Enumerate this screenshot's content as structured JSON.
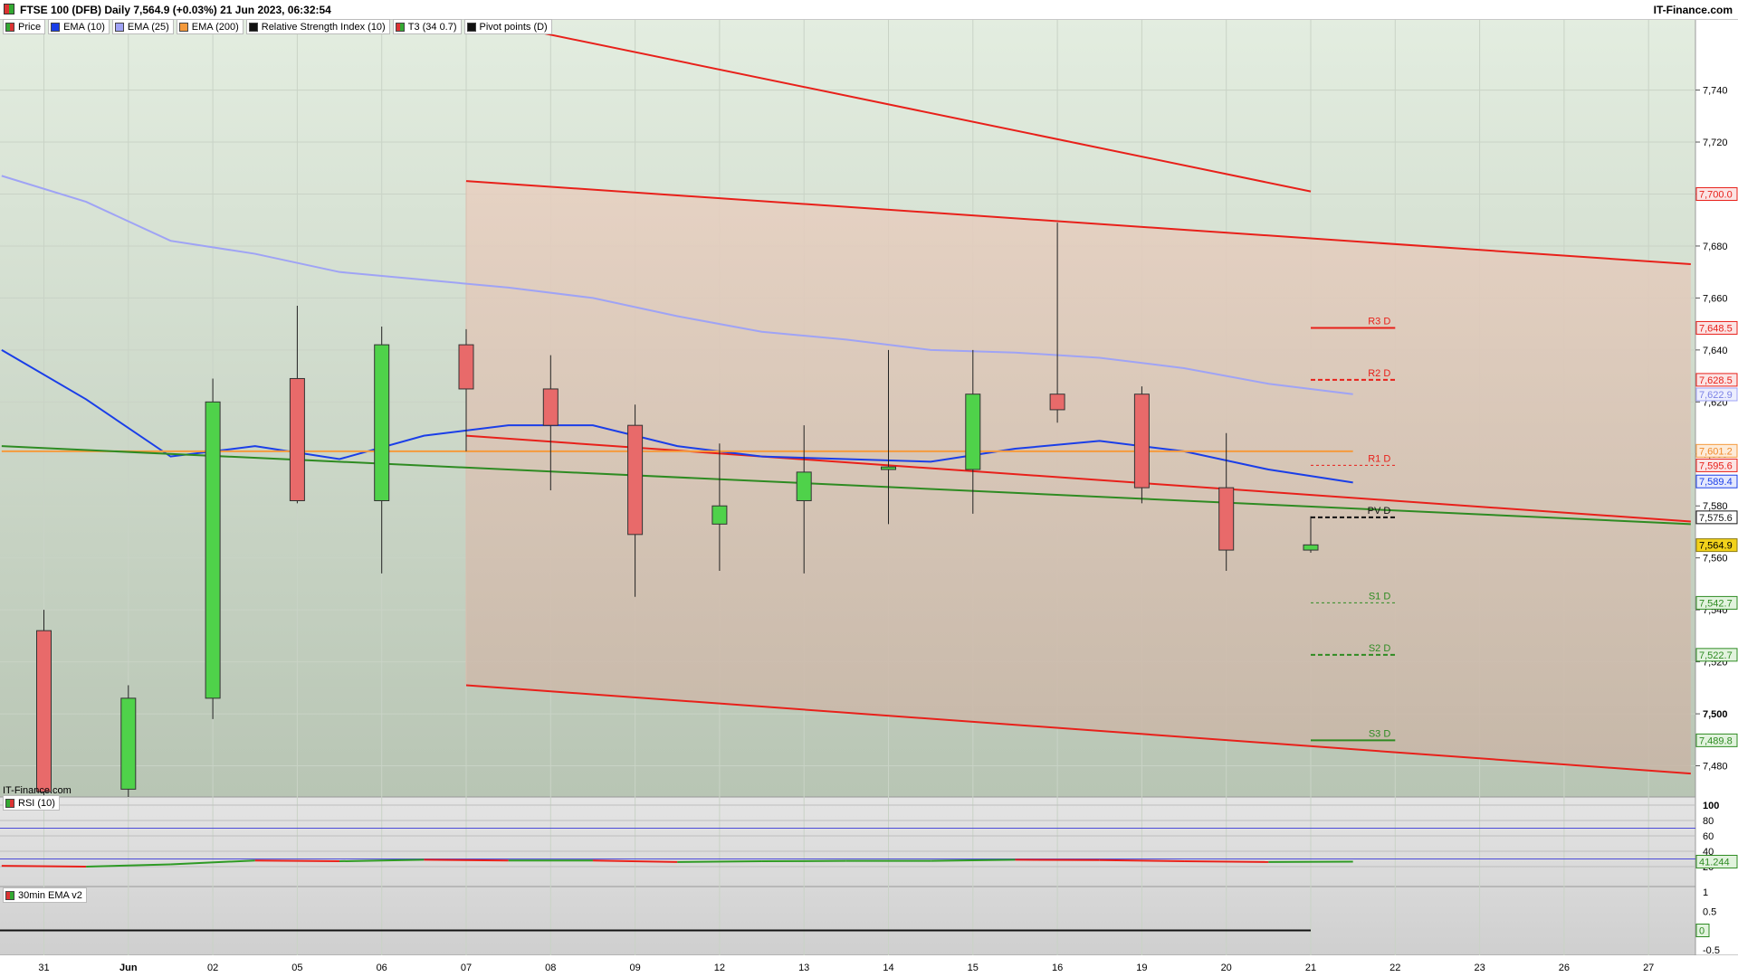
{
  "header": {
    "title": "FTSE 100 (DFB) Daily 7,564.9 (+0.03%) 21 Jun 2023, 06:32:54",
    "brand": "IT-Finance.com"
  },
  "legend": [
    {
      "label": "Price",
      "color": "#4caf50",
      "icon": "candle-icon"
    },
    {
      "label": "EMA (10)",
      "color": "#1a3ee8",
      "icon": "line-icon"
    },
    {
      "label": "EMA (25)",
      "color": "#9fa3f5",
      "icon": "line-icon"
    },
    {
      "label": "EMA (200)",
      "color": "#f59a3c",
      "icon": "line-icon"
    },
    {
      "label": "Relative Strength Index (10)",
      "color": "#111111",
      "icon": "line-icon"
    },
    {
      "label": "T3 (34 0.7)",
      "color": "#d9302e",
      "icon": "line-icon"
    },
    {
      "label": "Pivot points (D)",
      "color": "#111111",
      "icon": "line-icon"
    }
  ],
  "watermark": "IT-Finance.com",
  "rsi_panel": {
    "label": "RSI (10)",
    "current": "41.244"
  },
  "ema_panel": {
    "label": "30min EMA v2"
  },
  "chart_data": {
    "type": "candlestick",
    "title": "FTSE 100 (DFB) Daily",
    "x_labels": [
      "31",
      "Jun",
      "02",
      "05",
      "06",
      "07",
      "08",
      "09",
      "12",
      "13",
      "14",
      "15",
      "16",
      "19",
      "20",
      "21",
      "22",
      "23",
      "26",
      "27"
    ],
    "y_ticks": [
      7480,
      7500,
      7520,
      7540,
      7560,
      7580,
      7600,
      7620,
      7640,
      7660,
      7680,
      7700,
      7720,
      7740
    ],
    "ylim": [
      7468,
      7767
    ],
    "candles": [
      {
        "date": "31",
        "open": 7532,
        "high": 7540,
        "low": 7468,
        "close": 7470
      },
      {
        "date": "Jun",
        "open": 7471,
        "high": 7511,
        "low": 7468,
        "close": 7506
      },
      {
        "date": "02",
        "open": 7506,
        "high": 7629,
        "low": 7498,
        "close": 7620
      },
      {
        "date": "05",
        "open": 7629,
        "high": 7657,
        "low": 7581,
        "close": 7582
      },
      {
        "date": "06",
        "open": 7582,
        "high": 7649,
        "low": 7554,
        "close": 7642
      },
      {
        "date": "07",
        "open": 7642,
        "high": 7648,
        "low": 7601,
        "close": 7625
      },
      {
        "date": "08",
        "open": 7625,
        "high": 7638,
        "low": 7586,
        "close": 7611
      },
      {
        "date": "09",
        "open": 7611,
        "high": 7619,
        "low": 7545,
        "close": 7569
      },
      {
        "date": "12",
        "open": 7573,
        "high": 7604,
        "low": 7555,
        "close": 7580
      },
      {
        "date": "13",
        "open": 7582,
        "high": 7611,
        "low": 7554,
        "close": 7593
      },
      {
        "date": "14",
        "open": 7594,
        "high": 7640,
        "low": 7573,
        "close": 7595
      },
      {
        "date": "15",
        "open": 7594,
        "high": 7640,
        "low": 7577,
        "close": 7623
      },
      {
        "date": "16",
        "open": 7623,
        "high": 7689,
        "low": 7612,
        "close": 7617
      },
      {
        "date": "19",
        "open": 7623,
        "high": 7626,
        "low": 7581,
        "close": 7587
      },
      {
        "date": "20",
        "open": 7587,
        "high": 7608,
        "low": 7555,
        "close": 7563
      },
      {
        "date": "21",
        "open": 7563,
        "high": 7576,
        "low": 7562,
        "close": 7565
      }
    ],
    "series": [
      {
        "name": "EMA (10)",
        "color": "#1a3ee8",
        "values": [
          7640,
          7621,
          7599,
          7603,
          7598,
          7607,
          7611,
          7611,
          7603,
          7599,
          7598,
          7597,
          7602,
          7605,
          7601,
          7594,
          7589
        ]
      },
      {
        "name": "EMA (25)",
        "color": "#9fa3f5",
        "values": [
          7707,
          7697,
          7682,
          7677,
          7670,
          7667,
          7664,
          7660,
          7653,
          7647,
          7644,
          7640,
          7639,
          7637,
          7633,
          7627,
          7623
        ]
      },
      {
        "name": "EMA (200)",
        "color": "#f59a3c",
        "values": [
          7601,
          7601,
          7601,
          7601,
          7601,
          7601,
          7601,
          7601,
          7601,
          7601,
          7601,
          7601,
          7601,
          7601,
          7601,
          7601,
          7601
        ]
      },
      {
        "name": "trend",
        "color": "#2e8b22",
        "points": [
          [
            -0.5,
            7603
          ],
          [
            19.5,
            7573
          ]
        ]
      }
    ],
    "channel": {
      "fill_from": "07",
      "upper": [
        [
          5,
          7705
        ],
        [
          19.5,
          7673
        ]
      ],
      "lower": [
        [
          5,
          7511
        ],
        [
          19.5,
          7477
        ]
      ],
      "middle": [
        [
          5,
          7607
        ],
        [
          19.5,
          7574
        ]
      ],
      "top_line": [
        [
          5,
          7768
        ],
        [
          15,
          7701
        ]
      ]
    },
    "pivots": [
      {
        "label": "R3 D",
        "value": 7648.5,
        "color": "#e8201a",
        "style": "solid"
      },
      {
        "label": "R2 D",
        "value": 7628.5,
        "color": "#e8201a",
        "style": "dashed"
      },
      {
        "label": "R1 D",
        "value": 7595.6,
        "color": "#e8201a",
        "style": "dotted"
      },
      {
        "label": "PV D",
        "value": 7575.6,
        "color": "#111111",
        "style": "dashed"
      },
      {
        "label": "S1 D",
        "value": 7542.7,
        "color": "#2e8b22",
        "style": "dotted"
      },
      {
        "label": "S2 D",
        "value": 7522.7,
        "color": "#2e8b22",
        "style": "dashed"
      },
      {
        "label": "S3 D",
        "value": 7489.8,
        "color": "#2e8b22",
        "style": "solid"
      }
    ],
    "price_tags": [
      {
        "text": "7,700.0",
        "value": 7700.0,
        "bg": "#fbe4e4",
        "color": "#e8201a",
        "border": "#e8201a"
      },
      {
        "text": "7,648.5",
        "value": 7648.5,
        "bg": "#fbe4e4",
        "color": "#e8201a",
        "border": "#e8201a"
      },
      {
        "text": "7,628.5",
        "value": 7628.5,
        "bg": "#fbe4e4",
        "color": "#e8201a",
        "border": "#e8201a"
      },
      {
        "text": "7,622.9",
        "value": 7622.9,
        "bg": "#eceefe",
        "color": "#7c82e6",
        "border": "#9fa3f5"
      },
      {
        "text": "7,601.2",
        "value": 7601.2,
        "bg": "#fdebd8",
        "color": "#f08a2a",
        "border": "#f59a3c"
      },
      {
        "text": "7,595.6",
        "value": 7595.6,
        "bg": "#fbe4e4",
        "color": "#e8201a",
        "border": "#e8201a"
      },
      {
        "text": "7,589.4",
        "value": 7589.4,
        "bg": "#e4e8fd",
        "color": "#1a3ee8",
        "border": "#1a3ee8"
      },
      {
        "text": "7,575.6",
        "value": 7575.6,
        "bg": "#ffffff",
        "color": "#111111",
        "border": "#111111"
      },
      {
        "text": "7,564.9",
        "value": 7564.9,
        "bg": "#f2d21b",
        "color": "#000000",
        "border": "#8a7a10"
      },
      {
        "text": "7,542.7",
        "value": 7542.7,
        "bg": "#e2f3de",
        "color": "#2e8b22",
        "border": "#2e8b22"
      },
      {
        "text": "7,522.7",
        "value": 7522.7,
        "bg": "#e2f3de",
        "color": "#2e8b22",
        "border": "#2e8b22"
      },
      {
        "text": "7,489.8",
        "value": 7489.8,
        "bg": "#e2f3de",
        "color": "#2e8b22",
        "border": "#2e8b22"
      }
    ],
    "rsi": {
      "ticks": [
        "100",
        "80",
        "60",
        "40",
        "20"
      ],
      "levels": [
        70,
        30
      ],
      "values": [
        21,
        20,
        23,
        28,
        27,
        29,
        28,
        28,
        26,
        27,
        27.5,
        27.5,
        29,
        28.5,
        27,
        26,
        26.5
      ]
    },
    "ema30": {
      "ticks": [
        "1",
        "0.5",
        "0",
        "-0.5"
      ],
      "current": "0",
      "value": 0
    },
    "colors": {
      "up": "#4fd24a",
      "down": "#e86a6a",
      "wick": "#222222",
      "channel": "#e8201a",
      "upper_bg": "#e3ede0",
      "lower_bg": "#b8c5b4"
    }
  }
}
